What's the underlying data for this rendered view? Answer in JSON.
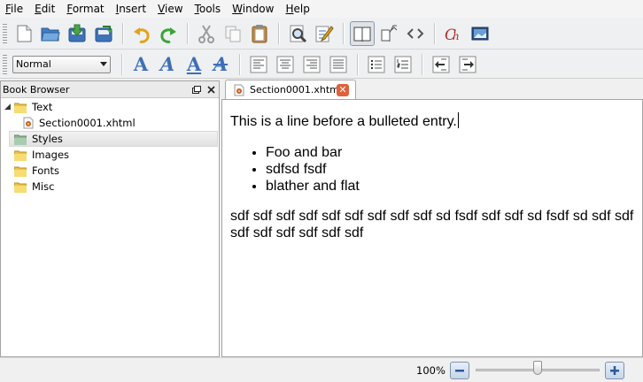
{
  "menubar": {
    "items": [
      {
        "label": "File"
      },
      {
        "label": "Edit"
      },
      {
        "label": "Format"
      },
      {
        "label": "Insert"
      },
      {
        "label": "View"
      },
      {
        "label": "Tools"
      },
      {
        "label": "Window"
      },
      {
        "label": "Help"
      }
    ]
  },
  "toolbar": {
    "style_select": {
      "value": "Normal"
    }
  },
  "book_browser": {
    "title": "Book Browser",
    "tree": [
      {
        "label": "Text",
        "icon": "folder-icon",
        "expanded": true
      },
      {
        "label": "Section0001.xhtml",
        "icon": "xhtml-file-icon"
      },
      {
        "label": "Styles",
        "icon": "folder-icon",
        "selected": true
      },
      {
        "label": "Images",
        "icon": "folder-icon"
      },
      {
        "label": "Fonts",
        "icon": "folder-icon"
      },
      {
        "label": "Misc",
        "icon": "folder-icon"
      }
    ]
  },
  "editor": {
    "tab": {
      "label": "Section0001.xhtml"
    },
    "content": {
      "intro": "This is a line before a bulleted entry.",
      "bullets": [
        "Foo and bar",
        "sdfsd fsdf",
        "blather and flat"
      ],
      "paragraph": "sdf sdf sdf sdf sdf sdf sdf sdf sdf sd fsdf sdf sdf sd fsdf sd sdf sdf sdf sdf sdf sdf sdf sdf"
    }
  },
  "statusbar": {
    "zoom": {
      "label": "100%",
      "level_fraction": 0.5
    }
  },
  "colors": {
    "accent_blue": "#3e6fb7",
    "tab_close": "#e0603a",
    "chapter_red": "#b02a2a"
  }
}
